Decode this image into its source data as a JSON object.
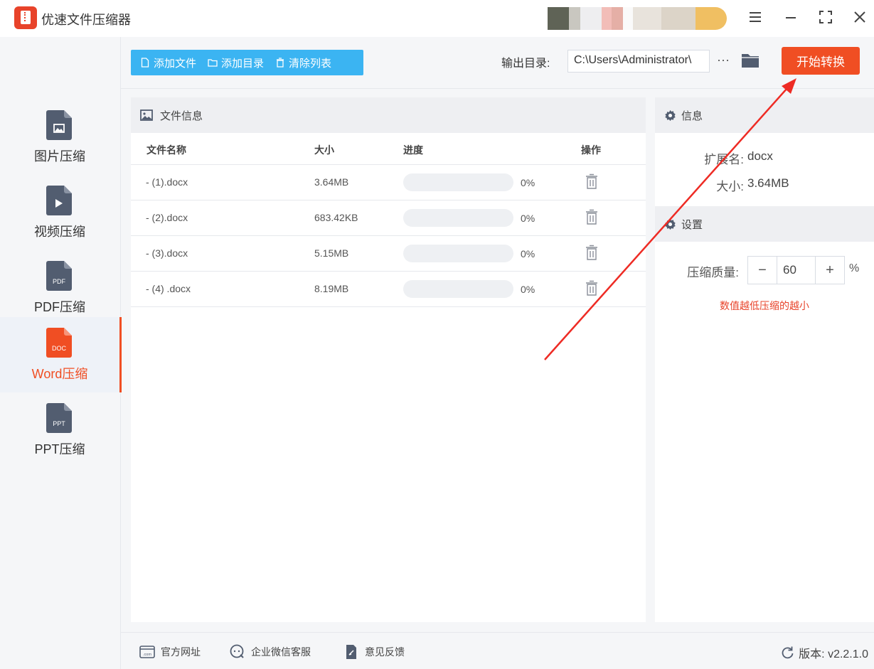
{
  "app": {
    "title": "优速文件压缩器"
  },
  "sidebar": {
    "items": [
      {
        "label": "图片压缩",
        "icon": "image-file-icon",
        "badge": ""
      },
      {
        "label": "视频压缩",
        "icon": "video-file-icon",
        "badge": ""
      },
      {
        "label": "PDF压缩",
        "icon": "pdf-file-icon",
        "badge": "PDF"
      },
      {
        "label": "Word压缩",
        "icon": "doc-file-icon",
        "badge": "DOC",
        "active": true
      },
      {
        "label": "PPT压缩",
        "icon": "ppt-file-icon",
        "badge": "PPT"
      }
    ]
  },
  "toolbar": {
    "add_file": "添加文件",
    "add_folder": "添加目录",
    "clear_list": "清除列表",
    "output_label": "输出目录:",
    "output_path": "C:\\Users\\Administrator\\",
    "more": "···",
    "start": "开始转换"
  },
  "file_panel": {
    "title": "文件信息",
    "columns": {
      "name": "文件名称",
      "size": "大小",
      "progress": "进度",
      "action": "操作"
    },
    "rows": [
      {
        "name": "- (1).docx",
        "size": "3.64MB",
        "progress_text": "0%",
        "progress": 0
      },
      {
        "name": "- (2).docx",
        "size": "683.42KB",
        "progress_text": "0%",
        "progress": 0
      },
      {
        "name": "- (3).docx",
        "size": "5.15MB",
        "progress_text": "0%",
        "progress": 0
      },
      {
        "name": "- (4) .docx",
        "size": "8.19MB",
        "progress_text": "0%",
        "progress": 0
      }
    ]
  },
  "info_panel": {
    "title": "信息",
    "ext_label": "扩展名:",
    "ext_value": "docx",
    "size_label": "大小:",
    "size_value": "3.64MB"
  },
  "settings_panel": {
    "title": "设置",
    "quality_label": "压缩质量:",
    "quality_value": "60",
    "minus": "−",
    "plus": "+",
    "unit": "%",
    "hint": "数值越低压缩的越小"
  },
  "footer": {
    "website": "官方网址",
    "wechat": "企业微信客服",
    "feedback": "意见反馈",
    "version": "版本: v2.2.1.0"
  },
  "colors": {
    "accent": "#f04e23",
    "toolbar": "#3bb4f2",
    "annotation": "#ee2b24"
  }
}
